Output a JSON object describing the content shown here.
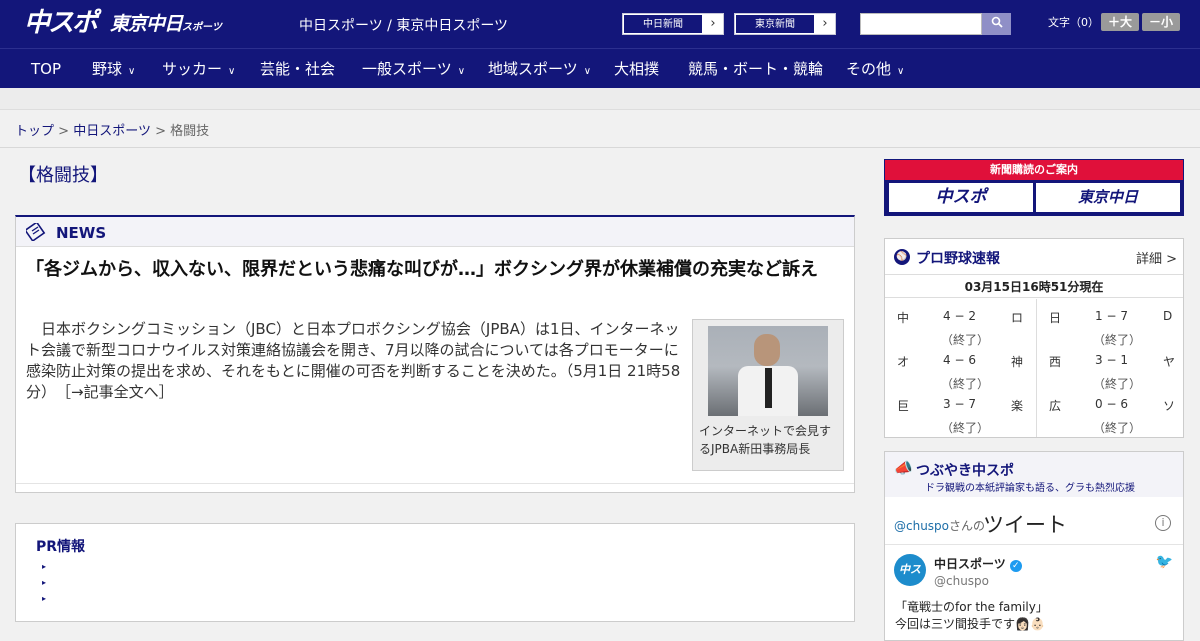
{
  "header": {
    "logo_main": "中スポ",
    "logo_tokyo": "東京中日",
    "logo_tokyo_small": "スポーツ",
    "site_title": "中日スポーツ / 東京中日スポーツ",
    "link_chunichi": "中日新聞",
    "link_tokyo": "東京新聞",
    "search_placeholder": "",
    "font_size_label": "文字（0）",
    "font_larger": "＋大",
    "font_smaller": "－小"
  },
  "nav": [
    {
      "label": "TOP"
    },
    {
      "label": "野球"
    },
    {
      "label": "サッカー"
    },
    {
      "label": "芸能・社会"
    },
    {
      "label": "一般スポーツ"
    },
    {
      "label": "地域スポーツ"
    },
    {
      "label": "大相撲"
    },
    {
      "label": "競馬・ボート・競輪"
    },
    {
      "label": "その他"
    }
  ],
  "breadcrumb": {
    "home": "トップ",
    "section": "中日スポーツ",
    "current": "格闘技",
    "sep": ">"
  },
  "page": {
    "section_title": "【格闘技】"
  },
  "news": {
    "label": "NEWS",
    "headline": "「各ジムから、収入ない、限界だという悲痛な叫びが…」ボクシング界が休業補償の充実など訴え",
    "body": "日本ボクシングコミッション（JBC）と日本プロボクシング協会（JPBA）は1日、インターネット会議で新型コロナウイルス対策連絡協議会を開き、7月以降の試合については各プロモーターに感染防止対策の提出を求め、それをもとに開催の可否を判断することを決めた。（5月1日 21時58分）　［→記事全文へ］",
    "photo_caption": "インターネットで会見するJPBA新田事務局長"
  },
  "pr": {
    "title": "PR情報",
    "bullets": [
      "▸",
      "▸",
      "▸"
    ]
  },
  "subscription": {
    "banner": "新聞購読のご案内",
    "btn_chuspo": "中スポ",
    "btn_tokyo": "東京中日"
  },
  "baseball": {
    "title": "プロ野球速報",
    "detail": "詳細 >",
    "timestamp": "03月15日16時51分現在",
    "games": [
      {
        "team1": "中",
        "score": "4 − 2",
        "team2": "ロ",
        "status": "（終了）"
      },
      {
        "team1": "日",
        "score": "1 − 7",
        "team2": "D",
        "status": "（終了）"
      },
      {
        "team1": "オ",
        "score": "4 − 6",
        "team2": "神",
        "status": "（終了）"
      },
      {
        "team1": "西",
        "score": "3 − 1",
        "team2": "ヤ",
        "status": "（終了）"
      },
      {
        "team1": "巨",
        "score": "3 − 7",
        "team2": "楽",
        "status": "（終了）"
      },
      {
        "team1": "広",
        "score": "0 − 6",
        "team2": "ソ",
        "status": "（終了）"
      }
    ]
  },
  "tweets": {
    "title": "つぶやき中スポ",
    "subtitle": "ドラ観戦の本紙評論家も語る、グラも熱烈応援",
    "handle": "@chuspo",
    "handle_suffix": "さんの",
    "tweet_word": "ツイート",
    "avatar_text": "中スポ",
    "account_name": "中日スポーツ",
    "account_at": "@chuspo",
    "text_line1": "「竜戦士のfor the family」",
    "text_line2": "今回は三ツ間投手です👩🏻👶🏻"
  }
}
